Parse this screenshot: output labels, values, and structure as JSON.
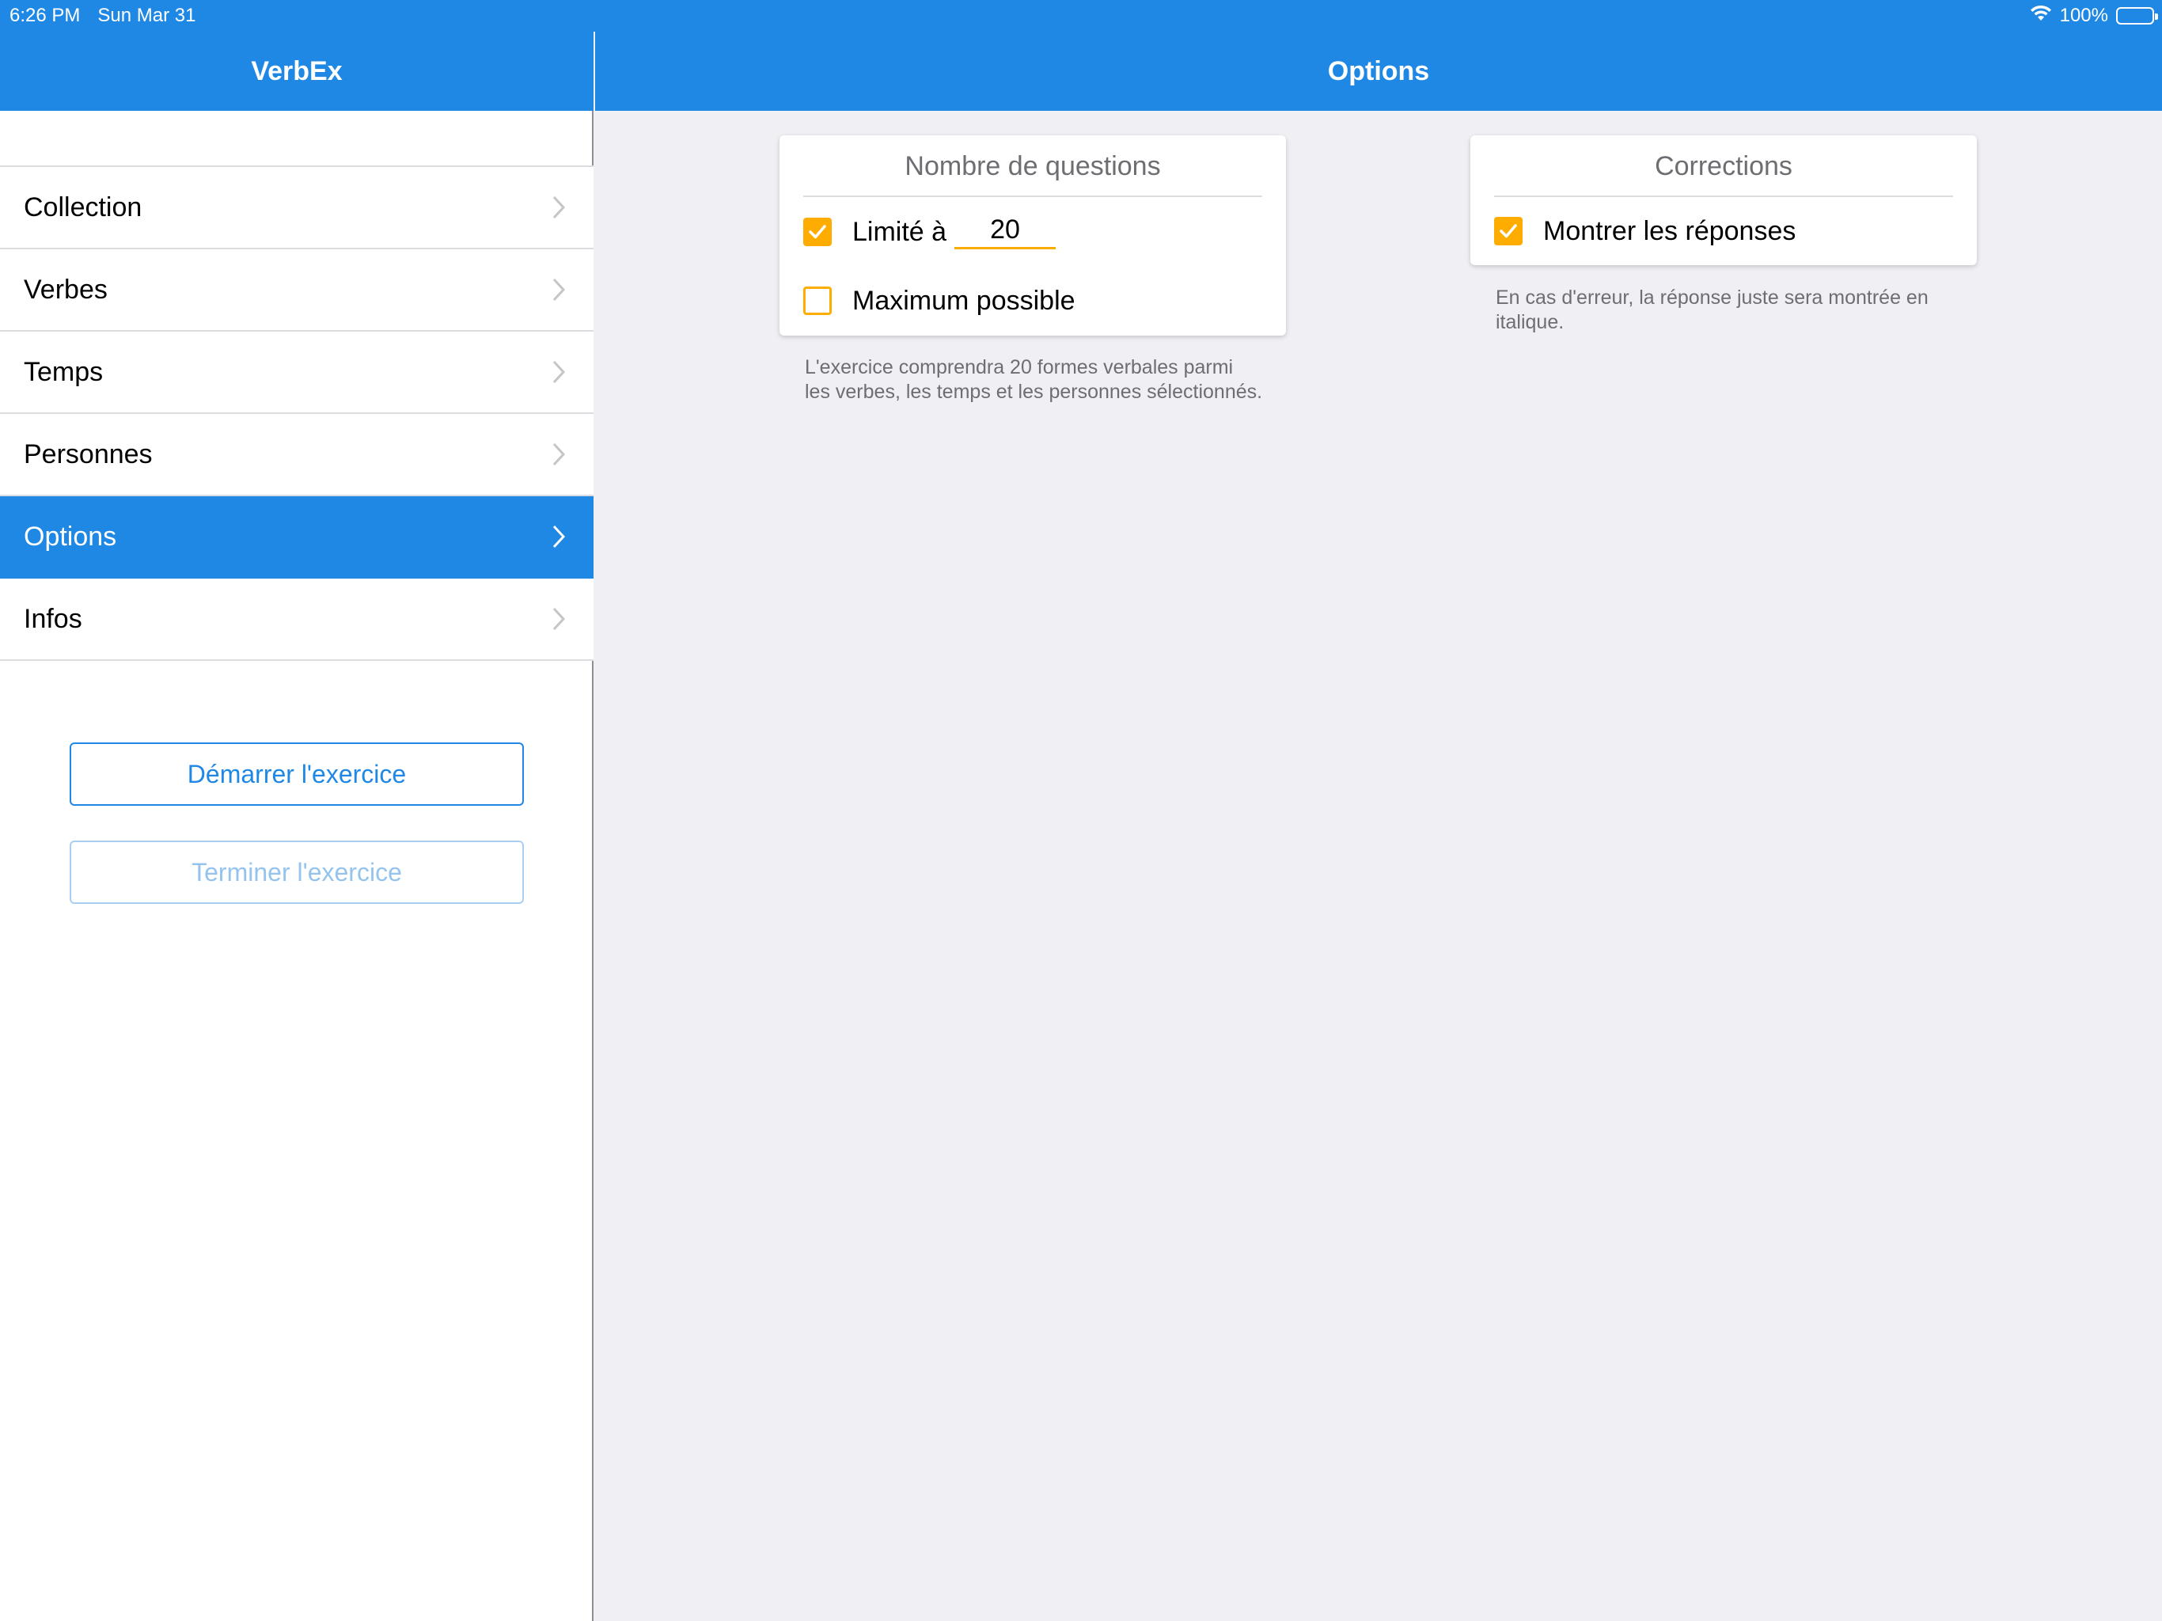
{
  "status_bar": {
    "time": "6:26 PM",
    "date": "Sun Mar 31",
    "battery": "100%"
  },
  "sidebar": {
    "title": "VerbEx",
    "items": [
      {
        "label": "Collection"
      },
      {
        "label": "Verbes"
      },
      {
        "label": "Temps"
      },
      {
        "label": "Personnes"
      },
      {
        "label": "Options"
      },
      {
        "label": "Infos"
      }
    ],
    "selected_index": 4,
    "start_button": "Démarrer l'exercice",
    "finish_button": "Terminer l'exercice"
  },
  "main": {
    "title": "Options",
    "questions_card": {
      "title": "Nombre de questions",
      "limited_label": "Limité à",
      "limited_checked": true,
      "limit_value": "20",
      "max_label": "Maximum possible",
      "max_checked": false,
      "footnote": "L'exercice comprendra 20 formes verbales parmi les verbes, les temps et les personnes sélectionnés."
    },
    "corrections_card": {
      "title": "Corrections",
      "show_answers_label": "Montrer les réponses",
      "show_answers_checked": true,
      "footnote": "En cas d'erreur, la réponse juste sera montrée en italique."
    }
  },
  "colors": {
    "accent": "#1f88e5",
    "checkbox": "#ffac00",
    "background": "#efeff4"
  },
  "icons": [
    "wifi-icon",
    "battery-icon",
    "chevron-right-icon",
    "checkmark-icon"
  ]
}
